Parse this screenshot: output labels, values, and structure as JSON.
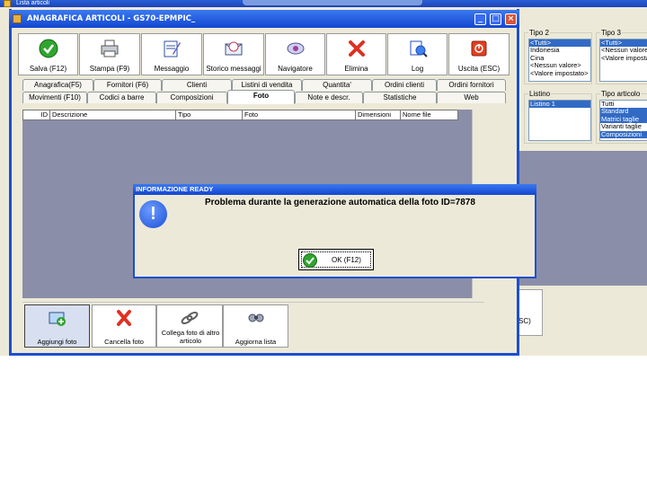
{
  "outer": {
    "title": "Lista articoli"
  },
  "window": {
    "title": "ANAGRAFICA ARTICOLI - GS70-EPMPIC_",
    "controls": [
      "_",
      "□",
      "×"
    ]
  },
  "toolbar": [
    {
      "label": "Salva (F12)",
      "icon": "save-check-icon"
    },
    {
      "label": "Stampa (F9)",
      "icon": "printer-icon"
    },
    {
      "label": "Messaggio",
      "icon": "message-icon"
    },
    {
      "label": "Storico messaggi",
      "icon": "message-history-icon"
    },
    {
      "label": "Navigatore",
      "icon": "navigator-icon"
    },
    {
      "label": "Elimina",
      "icon": "delete-icon"
    },
    {
      "label": "Log",
      "icon": "log-icon"
    },
    {
      "label": "Uscita (ESC)",
      "icon": "exit-icon"
    }
  ],
  "tabs_row1": [
    "Anagrafica(F5)",
    "Fornitori (F6)",
    "Clienti",
    "Listini di vendita",
    "Quantita'",
    "Ordini clienti",
    "Ordini fornitori"
  ],
  "tabs_row2": [
    "Movimenti (F10)",
    "Codici a barre",
    "Composizioni",
    "Foto",
    "Note e descr.",
    "Statistiche",
    "Web"
  ],
  "active_tab": "Foto",
  "grid": {
    "columns": [
      "ID",
      "Descrizione",
      "Tipo",
      "Foto",
      "Dimensioni",
      "Nome file"
    ]
  },
  "bottom_buttons": [
    {
      "label": "Aggiungi foto",
      "icon": "add-photo-icon"
    },
    {
      "label": "Cancella foto",
      "icon": "delete-photo-icon"
    },
    {
      "label": "Collega foto di altro articolo",
      "icon": "link-photo-icon"
    },
    {
      "label": "Aggiorna lista",
      "icon": "refresh-list-icon"
    }
  ],
  "right_panel": {
    "tipo2": {
      "title": "Tipo 2",
      "items": [
        "<Tutti>",
        "Indonesia",
        "Cina",
        "<Nessun valore>",
        "<Valore impostato>"
      ],
      "selected": 0
    },
    "tipo3": {
      "title": "Tipo 3",
      "items": [
        "<Tutti>",
        "<Nessun valore>",
        "<Valore impostato>"
      ],
      "selected": 0
    },
    "listino": {
      "title": "Listino",
      "items": [
        "Listino 1"
      ],
      "selected": 0
    },
    "tipo_articolo": {
      "title": "Tipo articolo",
      "items": [
        "Tutti",
        "Standard",
        "Matrici taglie",
        "Varianti taglie",
        "Composizioni"
      ],
      "selected": [
        1,
        2,
        4
      ]
    },
    "partial_button": "SC)"
  },
  "dialog": {
    "title": "INFORMAZIONE READY",
    "message": "Problema durante la generazione automatica della foto ID=7878",
    "ok_label": "OK (F12)",
    "icon": "info-icon"
  }
}
